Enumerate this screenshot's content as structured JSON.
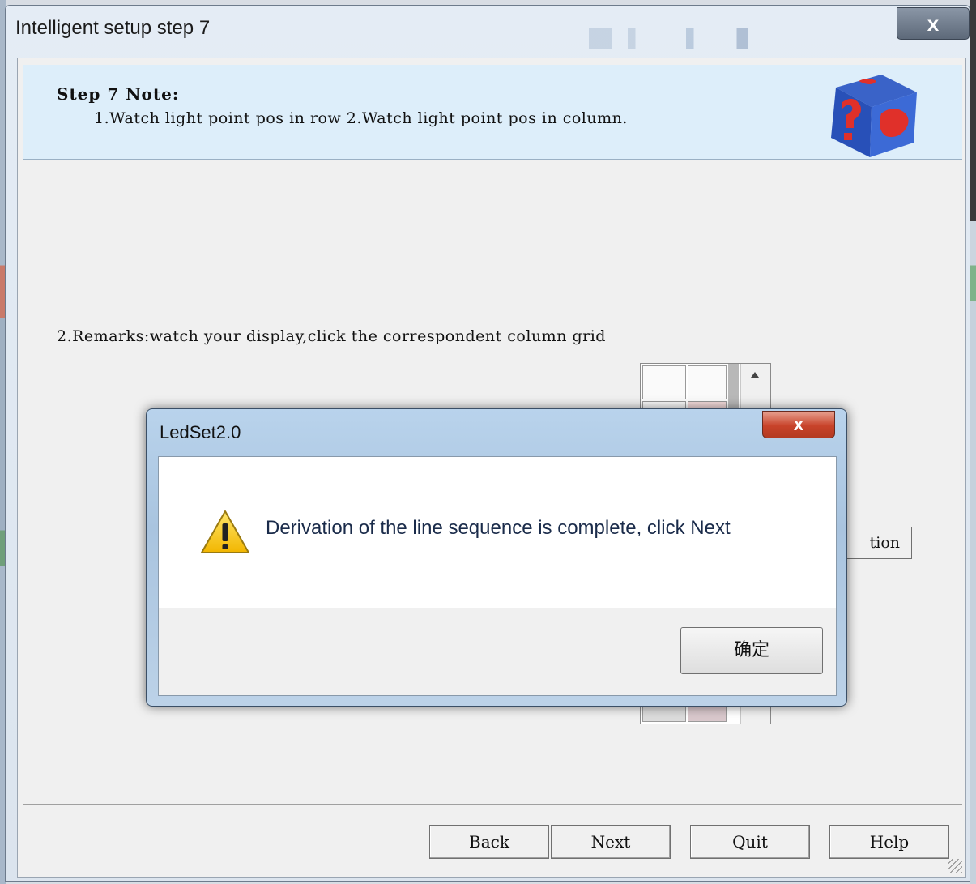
{
  "main_window": {
    "title": "Intelligent setup step 7",
    "close_glyph": "x",
    "step_title": "Step 7 Note:",
    "step_description": "1.Watch light point pos in row 2.Watch light point pos in column.",
    "remarks": "2.Remarks:watch your display,click the correspondent column grid",
    "partial_button_label": "tion",
    "buttons": {
      "back": "Back",
      "next": "Next",
      "quit": "Quit",
      "help": "Help"
    }
  },
  "message_box": {
    "title": "LedSet2.0",
    "close_glyph": "x",
    "message": "Derivation of the line sequence is complete, click Next",
    "ok_button": "确定"
  },
  "icons": {
    "warning": "warning-icon",
    "logo": "led-cube-icon",
    "scroll_up": "scroll-up-arrow-icon",
    "resize": "resize-grip-icon"
  }
}
